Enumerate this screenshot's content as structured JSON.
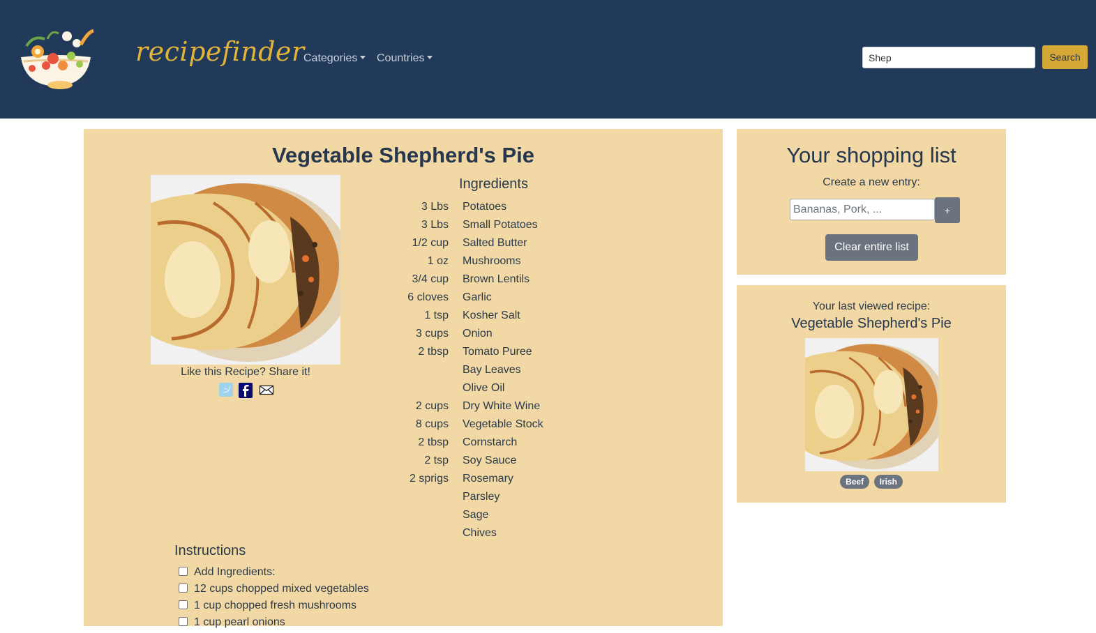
{
  "header": {
    "brand": "recipefinder",
    "nav": [
      {
        "label": "Categories"
      },
      {
        "label": "Countries"
      }
    ],
    "search_value": "Shep",
    "search_button": "Search"
  },
  "recipe": {
    "title": "Vegetable Shepherd's Pie",
    "share_text": "Like this Recipe? Share it!",
    "share_icons": [
      "twitter-icon",
      "facebook-icon",
      "mail-icon"
    ],
    "ingredients_heading": "Ingredients",
    "ingredients": [
      {
        "qty": "3 Lbs",
        "name": "Potatoes"
      },
      {
        "qty": "3 Lbs",
        "name": "Small Potatoes"
      },
      {
        "qty": "1/2 cup",
        "name": "Salted Butter"
      },
      {
        "qty": "1 oz",
        "name": "Mushrooms"
      },
      {
        "qty": "3/4 cup",
        "name": "Brown Lentils"
      },
      {
        "qty": "6 cloves",
        "name": "Garlic"
      },
      {
        "qty": "1 tsp",
        "name": "Kosher Salt"
      },
      {
        "qty": "3 cups",
        "name": "Onion"
      },
      {
        "qty": "2 tbsp",
        "name": "Tomato Puree"
      },
      {
        "qty": "",
        "name": "Bay Leaves"
      },
      {
        "qty": "",
        "name": "Olive Oil"
      },
      {
        "qty": "2 cups",
        "name": "Dry White Wine"
      },
      {
        "qty": "8 cups",
        "name": "Vegetable Stock"
      },
      {
        "qty": "2 tbsp",
        "name": "Cornstarch"
      },
      {
        "qty": "2 tsp",
        "name": "Soy Sauce"
      },
      {
        "qty": "2 sprigs",
        "name": "Rosemary"
      },
      {
        "qty": "",
        "name": "Parsley"
      },
      {
        "qty": "",
        "name": "Sage"
      },
      {
        "qty": "",
        "name": "Chives"
      }
    ],
    "instructions_heading": "Instructions",
    "instructions": [
      {
        "text": "Add Ingredients:",
        "checked": false
      },
      {
        "text": "12 cups chopped mixed vegetables",
        "checked": false
      },
      {
        "text": "1 cup chopped fresh mushrooms",
        "checked": false
      },
      {
        "text": "1 cup pearl onions",
        "checked": false
      }
    ]
  },
  "shopping": {
    "title": "Your shopping list",
    "subtitle": "Create a new entry:",
    "placeholder": "Bananas, Pork, ...",
    "add_button": "+",
    "clear_button": "Clear entire list"
  },
  "last_viewed": {
    "subtitle": "Your last viewed recipe:",
    "title": "Vegetable Shepherd's Pie",
    "tags": [
      "Beef",
      "Irish"
    ]
  },
  "colors": {
    "navbar": "#223a59",
    "brand": "#e0b43b",
    "panel": "#f2d8a4",
    "search_button": "#d6a936",
    "secondary_button": "#6b747e"
  }
}
